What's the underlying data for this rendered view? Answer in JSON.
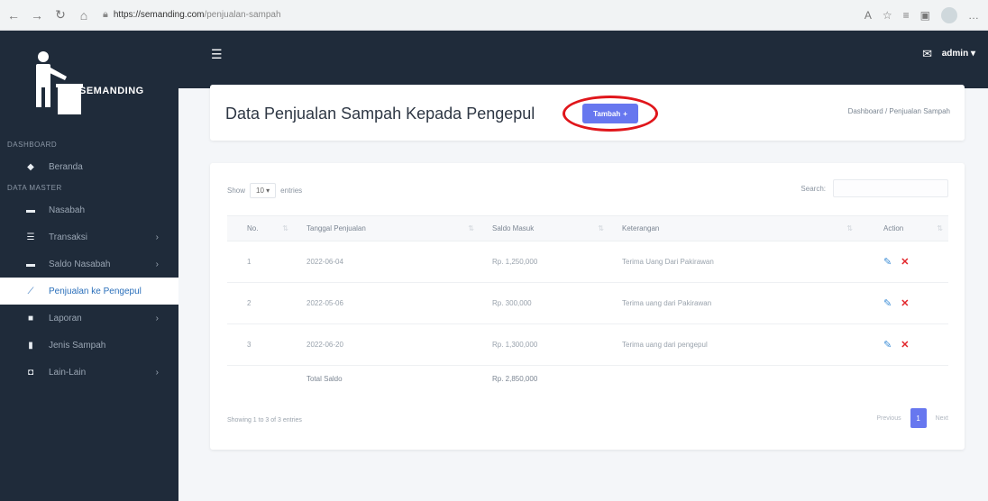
{
  "browser": {
    "host": "https://semanding.com",
    "path": "/penjualan-sampah"
  },
  "brand": {
    "name": "SEMANDING"
  },
  "sidebar": {
    "section_dashboard": "DASHBOARD",
    "section_master": "DATA MASTER",
    "items": [
      {
        "label": "Beranda",
        "icon": "home-icon"
      },
      {
        "label": "Nasabah",
        "icon": "users-icon"
      },
      {
        "label": "Transaksi",
        "icon": "list-icon"
      },
      {
        "label": "Saldo Nasabah",
        "icon": "wallet-icon"
      },
      {
        "label": "Penjualan ke Pengepul",
        "icon": "chart-icon"
      },
      {
        "label": "Laporan",
        "icon": "file-icon"
      },
      {
        "label": "Jenis Sampah",
        "icon": "trash-icon"
      },
      {
        "label": "Lain-Lain",
        "icon": "box-icon"
      }
    ]
  },
  "topnav": {
    "user": "admin"
  },
  "header": {
    "title": "Data Penjualan Sampah Kepada Pengepul",
    "add_label": "Tambah",
    "breadcrumb": "Dashboard / Penjualan Sampah"
  },
  "table": {
    "show_label": "Show",
    "entries_value": "10",
    "entries_label": "entries",
    "search_label": "Search:",
    "columns": [
      "No.",
      "Tanggal Penjualan",
      "Saldo Masuk",
      "Keterangan",
      "Action"
    ],
    "rows": [
      {
        "no": "1",
        "date": "2022-06-04",
        "amount": "Rp. 1,250,000",
        "note": "Terima Uang Dari Pakirawan"
      },
      {
        "no": "2",
        "date": "2022-05-06",
        "amount": "Rp. 300,000",
        "note": "Terima uang dari Pakirawan"
      },
      {
        "no": "3",
        "date": "2022-06-20",
        "amount": "Rp. 1,300,000",
        "note": "Terima uang dari pengepul"
      }
    ],
    "total_label": "Total Saldo",
    "total_value": "Rp. 2,850,000",
    "info": "Showing 1 to 3 of 3 entries",
    "prev": "Previous",
    "page": "1",
    "next": "Next"
  },
  "colors": {
    "sidebar_bg": "#1f2b3a",
    "accent": "#6777ef",
    "highlight": "#e0161b"
  }
}
